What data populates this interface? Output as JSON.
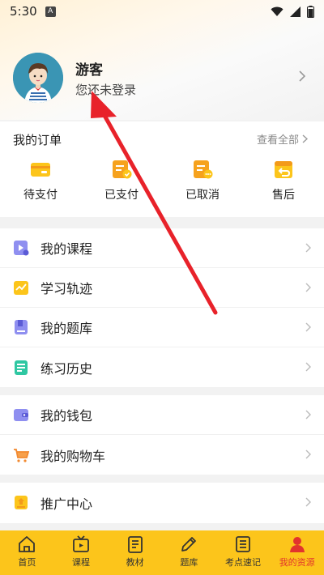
{
  "status_bar": {
    "time": "5:30",
    "notif_letter": "A"
  },
  "profile": {
    "name": "游客",
    "subtitle": "您还未登录"
  },
  "orders": {
    "title": "我的订单",
    "view_all": "查看全部",
    "items": [
      {
        "label": "待支付",
        "icon": "wallet-icon"
      },
      {
        "label": "已支付",
        "icon": "paid-doc-icon"
      },
      {
        "label": "已取消",
        "icon": "cancelled-doc-icon"
      },
      {
        "label": "售后",
        "icon": "return-icon"
      }
    ]
  },
  "menu_group_1": [
    {
      "label": "我的课程",
      "icon": "course-icon"
    },
    {
      "label": "学习轨迹",
      "icon": "chart-icon"
    },
    {
      "label": "我的题库",
      "icon": "question-bank-icon"
    },
    {
      "label": "练习历史",
      "icon": "history-icon"
    }
  ],
  "menu_group_2": [
    {
      "label": "我的钱包",
      "icon": "wallet-icon"
    },
    {
      "label": "我的购物车",
      "icon": "cart-icon"
    }
  ],
  "menu_group_3": [
    {
      "label": "推广中心",
      "icon": "promo-icon"
    }
  ],
  "bottom_nav": [
    {
      "label": "首页",
      "icon": "home-icon"
    },
    {
      "label": "课程",
      "icon": "tv-icon"
    },
    {
      "label": "教材",
      "icon": "book-icon"
    },
    {
      "label": "题库",
      "icon": "pencil-icon"
    },
    {
      "label": "考点速记",
      "icon": "list-icon"
    },
    {
      "label": "我的资源",
      "icon": "person-icon",
      "active": true
    }
  ],
  "colors": {
    "accent": "#fcc51b",
    "active_nav": "#e2342d",
    "annotation_arrow": "#e8222a"
  }
}
